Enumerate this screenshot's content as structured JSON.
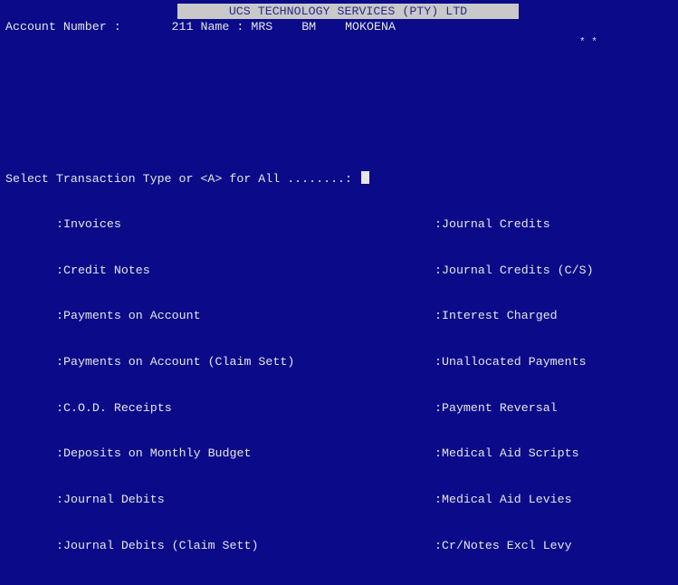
{
  "header": {
    "company_title": "UCS TECHNOLOGY SERVICES (PTY) LTD"
  },
  "account": {
    "account_label": "Account Number :",
    "account_number": "211",
    "name_label": "Name :",
    "name_value": "MRS    BM    MOKOENA",
    "stars": "* *"
  },
  "prompt": {
    "text": "Select Transaction Type or <A> for All ........:"
  },
  "left_options": [
    ":Invoices",
    ":Credit Notes",
    ":Payments on Account",
    ":Payments on Account (Claim Sett)",
    ":C.O.D. Receipts",
    ":Deposits on Monthly Budget",
    ":Journal Debits",
    ":Journal Debits (Claim Sett)"
  ],
  "right_options": [
    ":Journal Credits",
    ":Journal Credits (C/S)",
    ":Interest Charged",
    ":Unallocated Payments",
    ":Payment Reversal",
    ":Medical Aid Scripts",
    ":Medical Aid Levies",
    ":Cr/Notes Excl Levy"
  ],
  "colors": {
    "background": "#0b0b8a",
    "text": "#e6e6e6",
    "title_bar": "#c9c9c9"
  }
}
